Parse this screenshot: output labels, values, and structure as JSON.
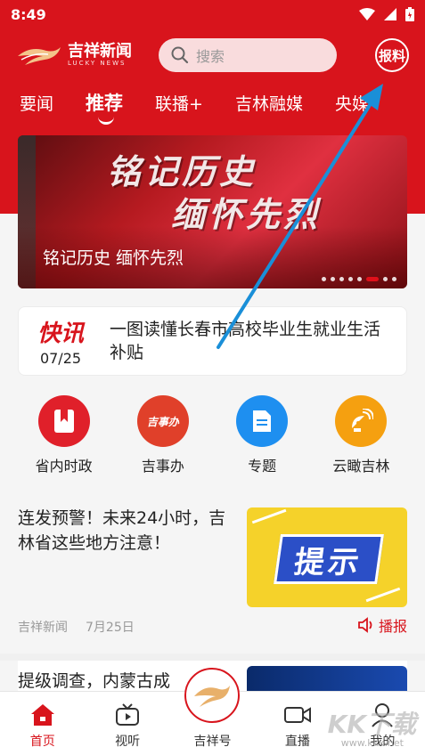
{
  "status": {
    "time": "8:49"
  },
  "header": {
    "logo_text": "吉祥新闻",
    "logo_sub": "LUCKY NEWS",
    "search_placeholder": "搜索",
    "report_label": "报料"
  },
  "tabs": [
    {
      "label": "要闻"
    },
    {
      "label": "推荐"
    },
    {
      "label": "联播+"
    },
    {
      "label": "吉林融媒"
    },
    {
      "label": "央媒"
    }
  ],
  "banner": {
    "headline_line1": "铭记历史",
    "headline_line2": "缅怀先烈",
    "caption": "铭记历史 缅怀先烈",
    "dot_count": 8,
    "active_dot": 5
  },
  "flash": {
    "label": "快讯",
    "date": "07/25",
    "text": "一图读懂长春市高校毕业生就业生活补贴"
  },
  "quick_links": [
    {
      "label": "省内时政",
      "icon": "bookmark-icon",
      "color": "#e0202a"
    },
    {
      "label": "吉事办",
      "icon": "jishiban-icon",
      "icon_text": "吉事办",
      "color": "#e0402a"
    },
    {
      "label": "专题",
      "icon": "document-icon",
      "color": "#1e8ff0"
    },
    {
      "label": "云瞰吉林",
      "icon": "satellite-icon",
      "color": "#f5a010"
    }
  ],
  "articles": [
    {
      "title": "连发预警！未来24小时，吉林省这些地方注意！",
      "thumb_text": "提示",
      "source": "吉祥新闻",
      "date": "7月25日",
      "play_label": "播报"
    },
    {
      "title": "提级调查，内蒙古成"
    }
  ],
  "bottom_nav": [
    {
      "label": "首页",
      "icon": "home-icon"
    },
    {
      "label": "视听",
      "icon": "tv-icon"
    },
    {
      "label": "吉祥号",
      "icon": "lucky-logo-icon"
    },
    {
      "label": "直播",
      "icon": "video-camera-icon"
    },
    {
      "label": "我的",
      "icon": "user-icon"
    }
  ],
  "watermark": {
    "text": "KK下载",
    "sub": "www.kkx.net"
  },
  "colors": {
    "brand_red": "#d8141c",
    "arrow_blue": "#1a8fd8"
  }
}
